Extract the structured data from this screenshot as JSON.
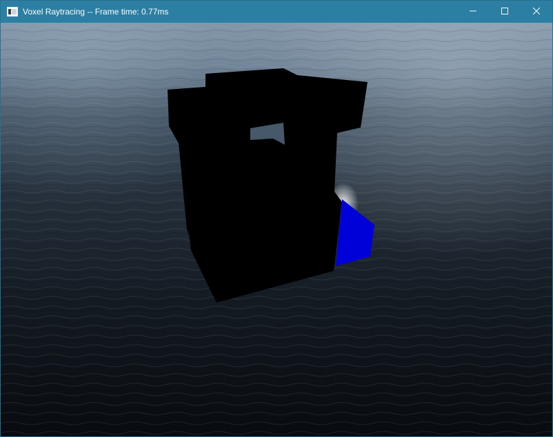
{
  "window": {
    "title": "Voxel Raytracing -- Frame time: 0.77ms",
    "icon": "app-window-icon",
    "controls": {
      "minimize_icon": "minimize-icon",
      "maximize_icon": "maximize-icon",
      "close_icon": "close-icon"
    }
  },
  "scene": {
    "background": "ocean-water-skybox",
    "object": "voxel-model",
    "colors": {
      "voxel_faces": "#000000",
      "voxel_highlight_face": "#0000d8",
      "water_dark": "#0b1016",
      "water_light": "#8ea3b6",
      "titlebar": "#2b7fa3"
    }
  }
}
